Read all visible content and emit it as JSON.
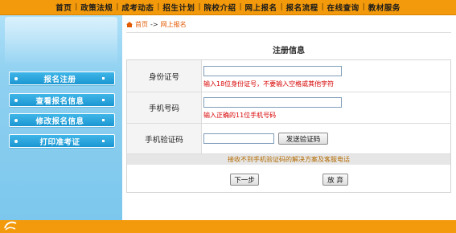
{
  "nav": {
    "items": [
      "首页",
      "政策法规",
      "成考动态",
      "招生计划",
      "院校介绍",
      "网上报名",
      "报名流程",
      "在线查询",
      "教材服务"
    ],
    "separator": "|"
  },
  "sidebar": {
    "items": [
      {
        "label": "报名注册"
      },
      {
        "label": "查看报名信息"
      },
      {
        "label": "修改报名信息"
      },
      {
        "label": "打印准考证"
      }
    ]
  },
  "breadcrumb": {
    "home": "首页",
    "arrow": "->",
    "current": "网上报名"
  },
  "form": {
    "title": "注册信息",
    "id_label": "身份证号",
    "id_value": "",
    "id_hint": "输入18位身份证号，不要输入空格或其他字符",
    "phone_label": "手机号码",
    "phone_value": "",
    "phone_hint": "输入正确的11位手机号码",
    "code_label": "手机验证码",
    "code_value": "",
    "send_code": "发送验证码",
    "notice": "接收不到手机验证码的解决方案及客服电话",
    "next": "下一步",
    "cancel": "放 弃"
  },
  "colors": {
    "orange": "#f39a0c",
    "sky": "#8fd0f0",
    "button_blue": "#1b96d2",
    "hint_red": "#d80000"
  }
}
